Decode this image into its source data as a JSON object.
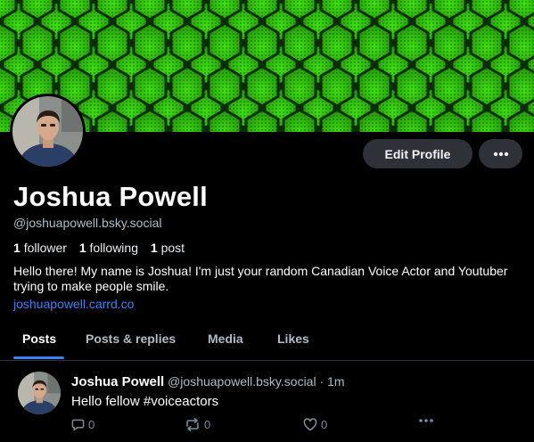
{
  "profile": {
    "display_name": "Joshua Powell",
    "handle": "@joshuapowell.bsky.social",
    "followers_count": "1",
    "followers_label": "follower",
    "following_count": "1",
    "following_label": "following",
    "posts_count": "1",
    "posts_label": "post",
    "bio": "Hello there! My name is Joshua! I'm just your random Canadian Voice Actor and Youtuber trying to make people smile.",
    "link": "joshuapowell.carrd.co",
    "banner_color": "#2fb80a"
  },
  "actions": {
    "edit_profile_label": "Edit Profile",
    "more_icon": "more-horizontal-icon"
  },
  "tabs": [
    {
      "label": "Posts",
      "active": true
    },
    {
      "label": "Posts & replies",
      "active": false
    },
    {
      "label": "Media",
      "active": false
    },
    {
      "label": "Likes",
      "active": false
    }
  ],
  "post": {
    "author": "Joshua Powell",
    "handle": "@joshuapowell.bsky.social",
    "separator": "·",
    "time": "1m",
    "text": "Hello fellow #voiceactors",
    "reply_count": "0",
    "repost_count": "0",
    "like_count": "0"
  },
  "colors": {
    "accent": "#3b82f6",
    "button_bg": "#2e3138",
    "muted_text": "#aebbc9"
  }
}
